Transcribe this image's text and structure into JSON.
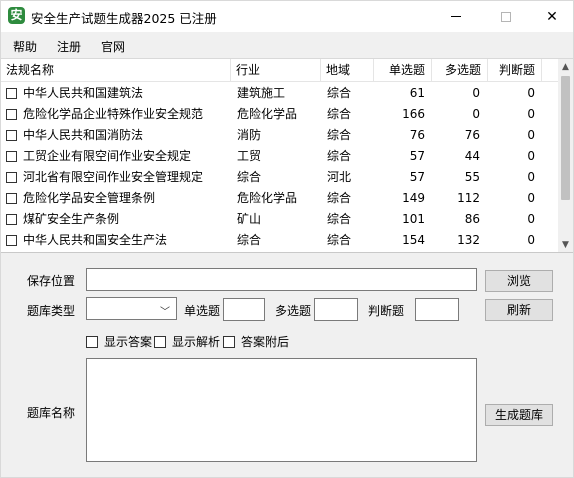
{
  "window": {
    "title": "安全生产试题生成器2025 已注册",
    "app_icon_glyph": "安",
    "close_glyph": "✕"
  },
  "menu": {
    "items": [
      "帮助",
      "注册",
      "官网"
    ]
  },
  "table": {
    "columns": [
      "法规名称",
      "行业",
      "地域",
      "单选题",
      "多选题",
      "判断题"
    ],
    "rows": [
      {
        "name": "中华人民共和国建筑法",
        "industry": "建筑施工",
        "region": "综合",
        "single": "61",
        "multi": "0",
        "judge": "0"
      },
      {
        "name": "危险化学品企业特殊作业安全规范",
        "industry": "危险化学品",
        "region": "综合",
        "single": "166",
        "multi": "0",
        "judge": "0"
      },
      {
        "name": "中华人民共和国消防法",
        "industry": "消防",
        "region": "综合",
        "single": "76",
        "multi": "76",
        "judge": "0"
      },
      {
        "name": "工贸企业有限空间作业安全规定",
        "industry": "工贸",
        "region": "综合",
        "single": "57",
        "multi": "44",
        "judge": "0"
      },
      {
        "name": "河北省有限空间作业安全管理规定",
        "industry": "综合",
        "region": "河北",
        "single": "57",
        "multi": "55",
        "judge": "0"
      },
      {
        "name": "危险化学品安全管理条例",
        "industry": "危险化学品",
        "region": "综合",
        "single": "149",
        "multi": "112",
        "judge": "0"
      },
      {
        "name": "煤矿安全生产条例",
        "industry": "矿山",
        "region": "综合",
        "single": "101",
        "multi": "86",
        "judge": "0"
      },
      {
        "name": "中华人民共和国安全生产法",
        "industry": "综合",
        "region": "综合",
        "single": "154",
        "multi": "132",
        "judge": "0"
      }
    ]
  },
  "form": {
    "save_location_label": "保存位置",
    "save_location_value": "",
    "browse_button": "浏览",
    "bank_type_label": "题库类型",
    "bank_type_value": "",
    "single_label": "单选题",
    "single_value": "",
    "multi_label": "多选题",
    "multi_value": "",
    "judge_label": "判断题",
    "judge_value": "",
    "refresh_button": "刷新",
    "show_answer_label": "显示答案",
    "show_analysis_label": "显示解析",
    "answer_after_label": "答案附后",
    "bank_name_label": "题库名称",
    "bank_name_value": "",
    "generate_button": "生成题库"
  }
}
